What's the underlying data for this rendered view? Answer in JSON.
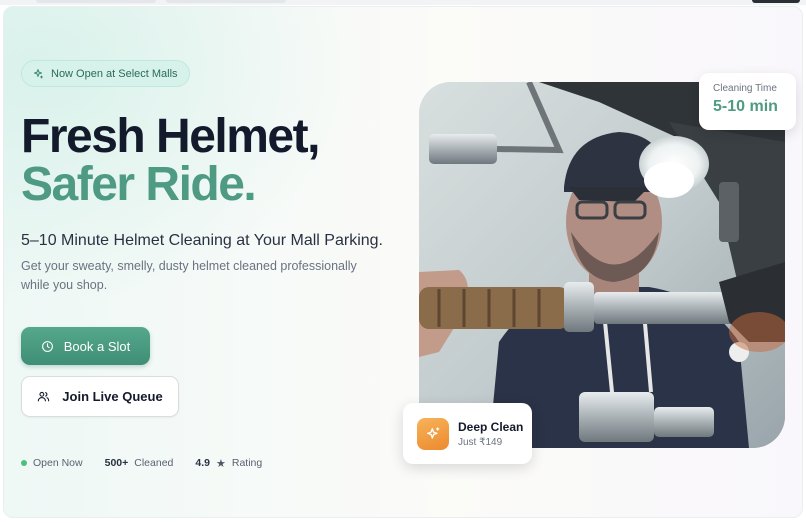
{
  "badge": {
    "text": "Now Open at Select Malls",
    "icon": "sparkle-icon"
  },
  "headline": {
    "line1": "Fresh Helmet,",
    "line2": "Safer Ride."
  },
  "subtitle": "5–10 Minute Helmet Cleaning at Your Mall Parking.",
  "description": "Get your sweaty, smelly, dusty helmet cleaned professionally while you shop.",
  "buttons": {
    "primary": {
      "label": "Book a Slot",
      "icon": "clock-icon"
    },
    "secondary": {
      "label": "Join Live Queue",
      "icon": "users-icon"
    }
  },
  "stats": {
    "open": "Open Now",
    "cleaned_value": "500+",
    "cleaned_label": "Cleaned",
    "rating_value": "4.9",
    "rating_star": "★",
    "rating_label": "Rating"
  },
  "cleaning_time_card": {
    "label": "Cleaning Time",
    "value": "5-10 min"
  },
  "deep_clean_card": {
    "title": "Deep Clean",
    "price": "Just ₹149",
    "icon": "sparkle-icon"
  },
  "colors": {
    "accent": "#4e9a82",
    "primary_button": "#4a9a80",
    "heading": "#131a2b",
    "status_green": "#4cc07a",
    "orange_icon": "#ef8f33"
  }
}
